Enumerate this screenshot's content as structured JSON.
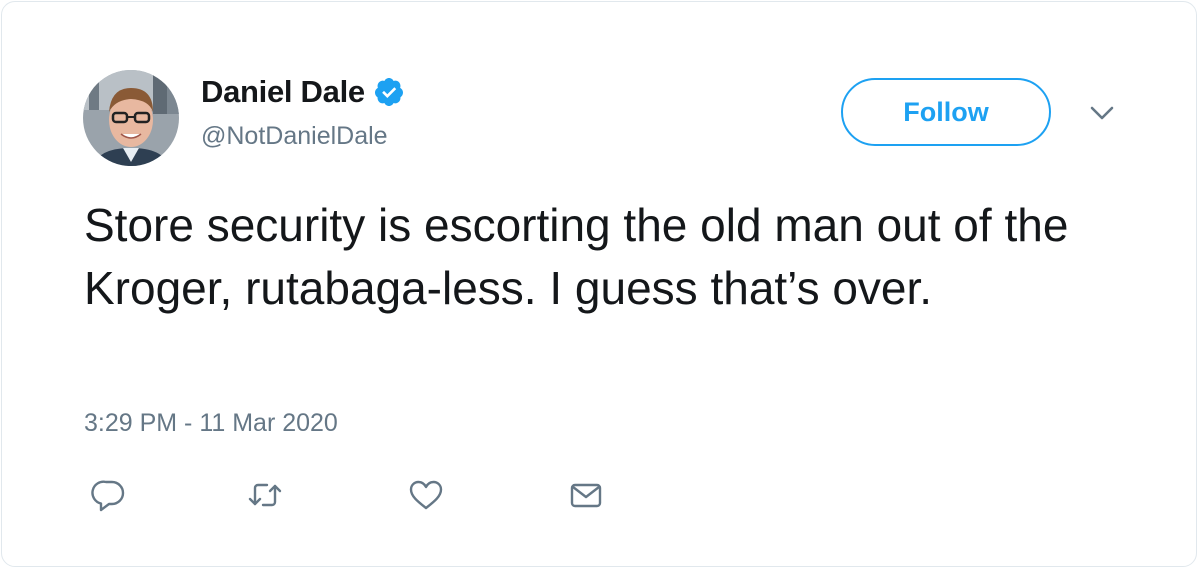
{
  "author": {
    "name": "Daniel Dale",
    "handle": "@NotDanielDale",
    "verified": true,
    "avatar_icon": "profile-photo"
  },
  "follow_button": {
    "label": "Follow"
  },
  "menu": {
    "icon": "chevron-down-icon"
  },
  "tweet": {
    "text": "Store security is escorting the old man out of the Kroger, rutabaga-less. I guess that’s over.",
    "timestamp": "3:29 PM - 11 Mar 2020"
  },
  "actions": [
    {
      "icon": "reply-icon"
    },
    {
      "icon": "retweet-icon"
    },
    {
      "icon": "like-icon"
    },
    {
      "icon": "message-icon"
    }
  ],
  "colors": {
    "accent": "#1da1f2",
    "text": "#14171a",
    "secondary": "#657786"
  }
}
